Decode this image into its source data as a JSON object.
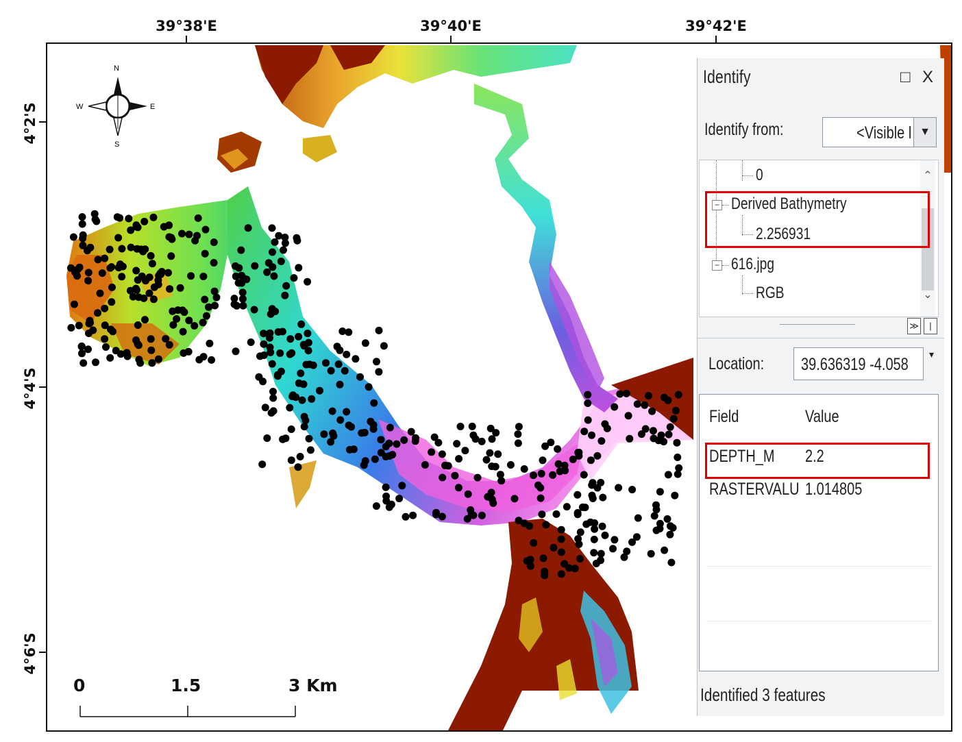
{
  "axis": {
    "top_labels": [
      "39°38'E",
      "39°40'E",
      "39°42'E"
    ],
    "left_labels": [
      "4°2'S",
      "4°4'S",
      "4°6'S"
    ]
  },
  "compass": {
    "n": "N",
    "e": "E",
    "s": "S",
    "w": "W"
  },
  "scalebar": {
    "ticks": [
      "0",
      "1.5",
      "3 Km"
    ]
  },
  "colors": {
    "land": "#8b1a00",
    "highlight": "#e00000",
    "survey_point": "#000000"
  },
  "identify": {
    "title": "Identify",
    "maximize_icon": "□",
    "close_icon": "X",
    "identify_from_label": "Identify from:",
    "identify_from_value": "<Visible l",
    "tree": [
      {
        "label": "0",
        "level": 2
      },
      {
        "label": "Derived Bathymetry",
        "level": 1
      },
      {
        "label": "2.256931",
        "level": 2
      },
      {
        "label": "616.jpg",
        "level": 1
      },
      {
        "label": "RGB",
        "level": 2
      }
    ],
    "location_label": "Location:",
    "location_value": "39.636319  -4.058",
    "field_header": "Field",
    "value_header": "Value",
    "rows": [
      {
        "field": "DEPTH_M",
        "value": "2.2"
      },
      {
        "field": "RASTERVALU",
        "value": "1.014805"
      }
    ],
    "status": "Identified 3 features"
  }
}
